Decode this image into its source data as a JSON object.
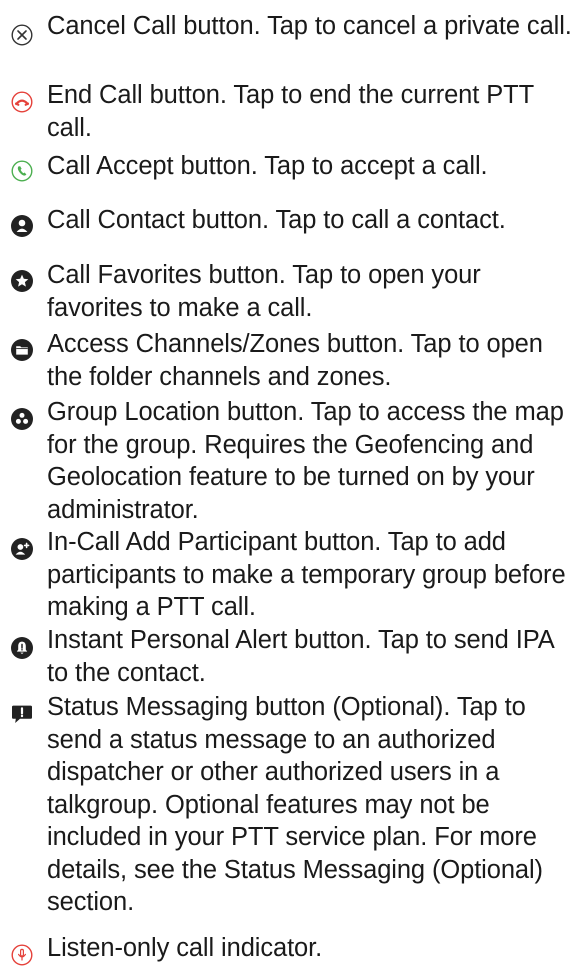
{
  "items": [
    {
      "icon": "cancel-x-icon",
      "icon_color": "#333333",
      "text": "Cancel Call button. Tap to cancel a private call."
    },
    {
      "icon": "end-call-icon",
      "icon_color": "#e5413a",
      "text": "End Call button. Tap to end the current PTT call."
    },
    {
      "icon": "call-accept-icon",
      "icon_color": "#4caf50",
      "text": "Call Accept button. Tap to accept a call."
    },
    {
      "icon": "contact-person-icon",
      "icon_color": "#222222",
      "text": "Call Contact button. Tap to call a contact."
    },
    {
      "icon": "favorites-star-icon",
      "icon_color": "#222222",
      "text": "Call Favorites button. Tap to open your favorites to make a call."
    },
    {
      "icon": "folder-icon",
      "icon_color": "#222222",
      "text": "Access Channels/Zones button. Tap to open the folder channels and zones."
    },
    {
      "icon": "group-location-icon",
      "icon_color": "#222222",
      "text": "Group Location button. Tap to access the map for the group. Requires the Geofencing and Geolocation feature to be turned on by your administrator."
    },
    {
      "icon": "add-participant-icon",
      "icon_color": "#222222",
      "text": "In-Call Add Participant button. Tap to add participants to make a temporary group before making a PTT call."
    },
    {
      "icon": "personal-alert-bell-icon",
      "icon_color": "#222222",
      "text": "Instant Personal Alert button. Tap to send IPA to the contact."
    },
    {
      "icon": "status-message-icon",
      "icon_color": "#222222",
      "text": "Status Messaging button (Optional). Tap to send a status message to an authorized dispatcher or other authorized users in a talkgroup. Optional features may not be included in your PTT service plan. For more details, see the Status Messaging (Optional) section."
    },
    {
      "icon": "listen-only-icon",
      "icon_color": "#e5413a",
      "text": "Listen-only call indicator."
    }
  ]
}
